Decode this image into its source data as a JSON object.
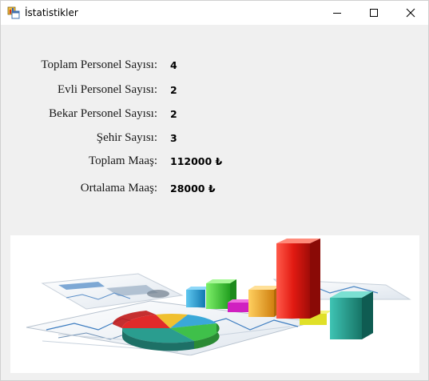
{
  "window": {
    "title": "İstatistikler"
  },
  "stats": [
    {
      "label": "Toplam Personel Sayısı:",
      "value": "4"
    },
    {
      "label": "Evli Personel Sayısı:",
      "value": "2"
    },
    {
      "label": "Bekar Personel Sayısı:",
      "value": "2"
    },
    {
      "label": "Şehir Sayısı:",
      "value": "3"
    },
    {
      "label": "Toplam Maaş:",
      "value": "112000 ₺"
    },
    {
      "label": "Ortalama Maaş:",
      "value": "28000 ₺"
    }
  ],
  "colors": {
    "window_bg": "#f0f0f0",
    "titlebar_bg": "#ffffff",
    "bar_red": "#e8201c",
    "bar_teal": "#2a9d8f",
    "bar_green": "#3cc43c",
    "bar_orange": "#f0a020",
    "bar_blue": "#2090d0",
    "bar_magenta": "#d020c0"
  }
}
